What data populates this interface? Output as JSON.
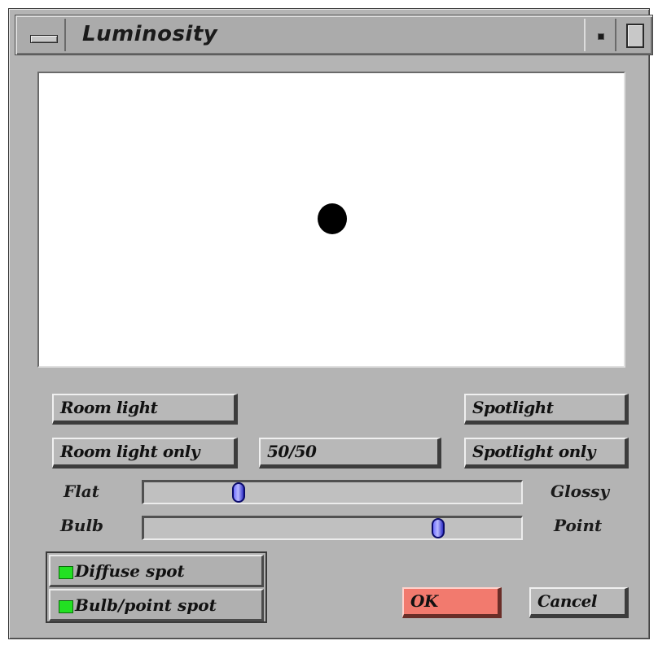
{
  "window": {
    "title": "Luminosity"
  },
  "buttons": {
    "room_light": "Room light",
    "spotlight": "Spotlight",
    "room_light_only": "Room light only",
    "mix": "50/50",
    "spotlight_only": "Spotlight only",
    "ok": "OK",
    "cancel": "Cancel"
  },
  "sliders": {
    "finish": {
      "left_label": "Flat",
      "right_label": "Glossy",
      "value_fraction": 0.25
    },
    "source": {
      "left_label": "Bulb",
      "right_label": "Point",
      "value_fraction": 0.78
    }
  },
  "toggles": {
    "diffuse_spot": {
      "label": "Diffuse spot",
      "on": true
    },
    "bulb_point_spot": {
      "label": "Bulb/point spot",
      "on": true
    }
  },
  "colors": {
    "ok_button": "#f27a6e",
    "indicator_on": "#22e022",
    "slider_thumb": "#7070ff"
  }
}
